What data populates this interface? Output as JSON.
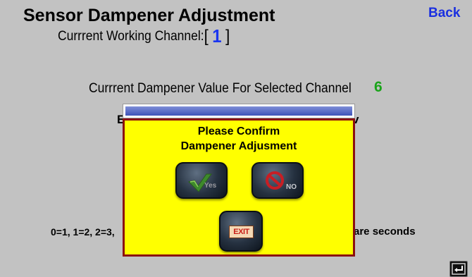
{
  "header": {
    "title": "Sensor Dampener Adjustment",
    "back_label": "Back"
  },
  "channel": {
    "label": "Currrent Working Channel:",
    "open_bracket": "[",
    "value": "1",
    "close_bracket": "]"
  },
  "dampener": {
    "label": "Currrent Dampener Value For Selected Channel",
    "value": "6"
  },
  "background_fragments": {
    "left_partial": "E",
    "right_partial": "v"
  },
  "range_text": {
    "left": "0=1, 1=2, 2=3,",
    "right": "are seconds"
  },
  "dialog": {
    "title_line1": "Please Confirm",
    "title_line2": "Dampener Adjusment",
    "yes_label": "Yes",
    "no_label": "NO",
    "exit_label": "EXIT"
  },
  "colors": {
    "background": "#c2c2c2",
    "back_link": "#1a2fe0",
    "channel_value": "#1a35f0",
    "dampener_value": "#1aa41a",
    "dialog_fill": "#ffff00",
    "dialog_border": "#8b1010"
  },
  "icons": {
    "yes": "checkmark-icon",
    "no": "prohibited-icon",
    "exit": "exit-sign-icon",
    "corner": "enter-return-icon"
  }
}
